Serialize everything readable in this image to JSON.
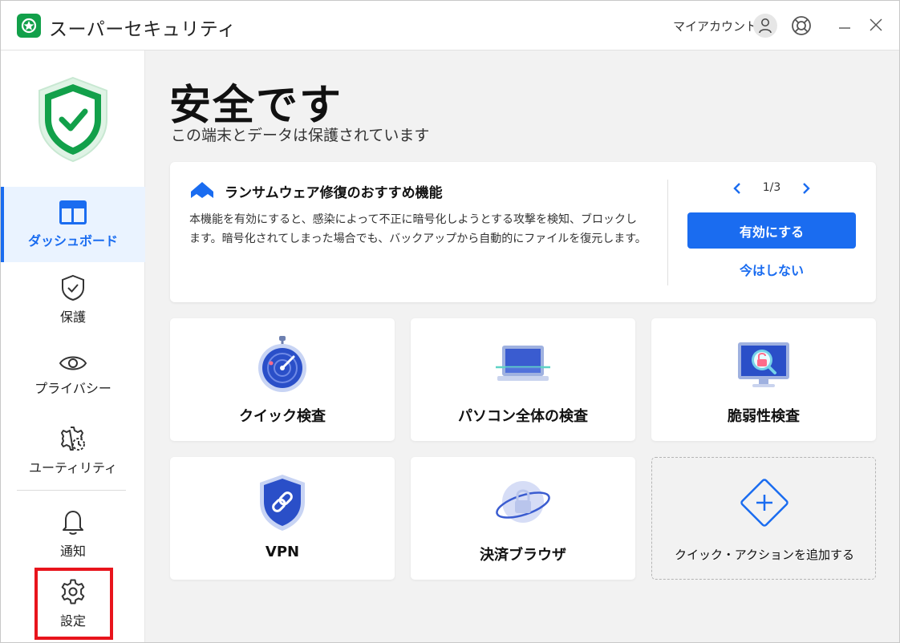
{
  "app": {
    "title": "スーパーセキュリティ",
    "account_label": "マイアカウント"
  },
  "sidebar": {
    "items": [
      {
        "label": "ダッシュボード",
        "icon": "dashboard-icon",
        "active": true
      },
      {
        "label": "保護",
        "icon": "shield-check-icon"
      },
      {
        "label": "プライバシー",
        "icon": "eye-icon"
      },
      {
        "label": "ユーティリティ",
        "icon": "gear-clock-icon"
      },
      {
        "label": "通知",
        "icon": "bell-icon"
      },
      {
        "label": "設定",
        "icon": "settings-gear-icon"
      }
    ]
  },
  "main": {
    "title": "安全です",
    "subtitle": "この端末とデータは保護されています"
  },
  "promo": {
    "title": "ランサムウェア修復のおすすめ機能",
    "body": "本機能を有効にすると、感染によって不正に暗号化しようとする攻撃を検知、ブロックします。暗号化されてしまった場合でも、バックアップから自動的にファイルを復元します。",
    "pager": "1/3",
    "enable_label": "有効にする",
    "later_label": "今はしない"
  },
  "tiles": [
    {
      "label": "クイック検査",
      "icon": "stopwatch-radar-icon"
    },
    {
      "label": "パソコン全体の検査",
      "icon": "laptop-scan-icon"
    },
    {
      "label": "脆弱性検査",
      "icon": "monitor-lock-icon"
    },
    {
      "label": "VPN",
      "icon": "shield-link-icon"
    },
    {
      "label": "決済ブラウザ",
      "icon": "globe-lock-icon"
    },
    {
      "label": "クイック・アクションを追加する",
      "icon": "add-diamond-icon"
    }
  ],
  "colors": {
    "accent": "#1a6cf0",
    "brand_green": "#12a04a",
    "highlight_red": "#e8141c"
  }
}
